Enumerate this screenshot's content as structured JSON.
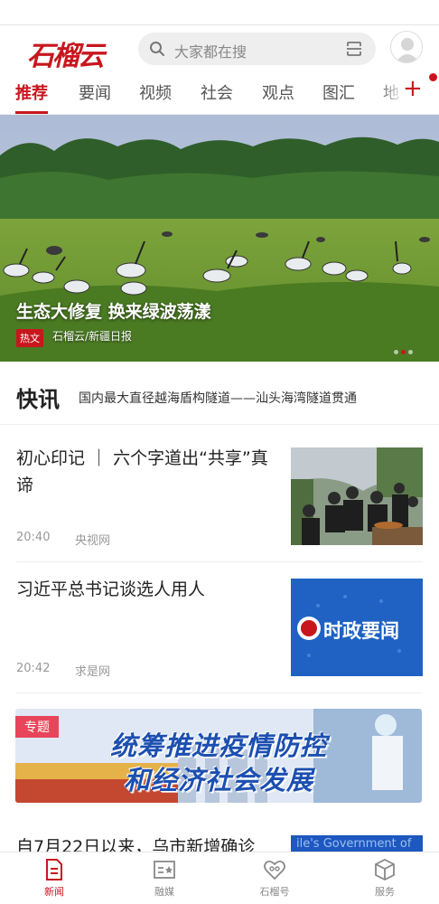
{
  "header": {
    "logo_text": "石榴云",
    "search_placeholder": "大家都在搜"
  },
  "tabs": [
    {
      "label": "推荐",
      "active": true
    },
    {
      "label": "要闻"
    },
    {
      "label": "视频"
    },
    {
      "label": "社会"
    },
    {
      "label": "观点"
    },
    {
      "label": "图汇"
    },
    {
      "label": "地"
    }
  ],
  "tab_add_label": "+",
  "banner": {
    "title": "生态大修复  换来绿波荡漾",
    "tag": "热文",
    "source": "石榴云/新疆日报",
    "slide_count": 3,
    "active_slide": 2
  },
  "flash": {
    "label": "快讯",
    "text": "国内最大直径越海盾构隧道——汕头海湾隧道贯通"
  },
  "news": [
    {
      "title": "初心印记 ｜ 六个字道出“共享”真谛",
      "time": "20:40",
      "source": "央视网"
    },
    {
      "title": "习近平总书记谈选人用人",
      "time": "20:42",
      "source": "求是网",
      "thumb_text": "时政要闻"
    }
  ],
  "special": {
    "tag": "专题",
    "line1": "统筹推进疫情防控",
    "line2": "和经济社会发展"
  },
  "partial_news": {
    "title": "自7月22日以来，乌市新增确诊",
    "thumb_text": "ile's Government of"
  },
  "bottom_nav": [
    {
      "label": "新闻",
      "icon": "news-doc-icon",
      "active": true
    },
    {
      "label": "融媒",
      "icon": "media-board-icon"
    },
    {
      "label": "石榴号",
      "icon": "heart-pomegranate-icon"
    },
    {
      "label": "服务",
      "icon": "box-cube-icon"
    }
  ],
  "colors": {
    "accent": "#c8161d",
    "special_blue": "#1c4fb0"
  }
}
